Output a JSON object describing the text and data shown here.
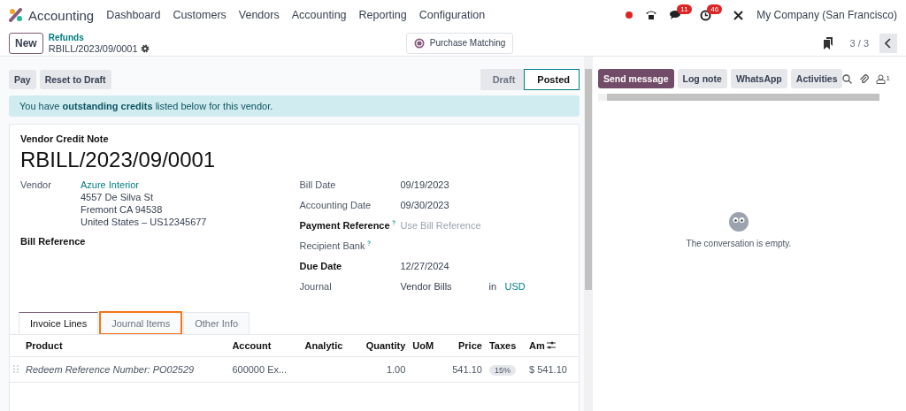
{
  "navbar": {
    "app": "Accounting",
    "menu": [
      "Dashboard",
      "Customers",
      "Vendors",
      "Accounting",
      "Reporting",
      "Configuration"
    ],
    "messages_badge": "11",
    "activities_badge": "46",
    "company": "My Company (San Francisco)"
  },
  "control_panel": {
    "new_button": "New",
    "breadcrumb": "Refunds",
    "record": "RBILL/2023/09/0001",
    "smart_button": "Purchase Matching",
    "pager": "3 / 3"
  },
  "actions": [
    "Pay",
    "Reset to Draft"
  ],
  "statusbar": [
    {
      "label": "Draft",
      "selected": false
    },
    {
      "label": "Posted",
      "selected": true
    }
  ],
  "alert": "You have **outstanding credits** listed below for this vendor.",
  "form": {
    "type": "Vendor Credit Note",
    "number": "RBILL/2023/09/0001",
    "vendor_label": "Vendor",
    "vendor": "Azure Interior",
    "address": [
      "4557 De Silva St",
      "Fremont CA 94538",
      "United States – US12345677"
    ],
    "bill_reference_label": "Bill Reference",
    "fields": [
      {
        "label": "Bill Date",
        "bold": false,
        "help": false,
        "value": "09/19/2023",
        "kind": "text"
      },
      {
        "label": "Accounting Date",
        "bold": false,
        "help": false,
        "value": "09/30/2023",
        "kind": "text"
      },
      {
        "label": "Payment Reference",
        "bold": true,
        "help": true,
        "placeholder": "Use Bill Reference",
        "kind": "placeholder"
      },
      {
        "label": "Recipient Bank",
        "bold": false,
        "help": true,
        "kind": "empty"
      },
      {
        "label": "Due Date",
        "bold": true,
        "help": false,
        "value": "12/27/2024",
        "kind": "text"
      },
      {
        "label": "Journal",
        "bold": false,
        "help": false,
        "value": "Vendor Bills",
        "kind": "journal",
        "in": "in",
        "currency": "USD"
      }
    ]
  },
  "tabs": [
    {
      "label": "Invoice Lines",
      "selected": true,
      "highlighted": false
    },
    {
      "label": "Journal Items",
      "selected": false,
      "highlighted": true
    },
    {
      "label": "Other Info",
      "selected": false,
      "highlighted": false
    }
  ],
  "table": {
    "columns": [
      "Product",
      "Account",
      "Analytic",
      "Quantity",
      "UoM",
      "Price",
      "Taxes",
      "Am"
    ],
    "rows": [
      {
        "product": "Redeem Reference Number: PO02529",
        "account": "600000 Ex...",
        "quantity": "1.00",
        "price": "541.10",
        "taxes": "15%",
        "amount": "$ 541.10"
      }
    ]
  },
  "chatter": {
    "buttons": [
      {
        "label": "Send message",
        "selected": true
      },
      {
        "label": "Log note",
        "selected": false
      },
      {
        "label": "WhatsApp",
        "selected": false
      },
      {
        "label": "Activities",
        "selected": false
      }
    ],
    "followers": "1",
    "empty": "The conversation is empty."
  }
}
